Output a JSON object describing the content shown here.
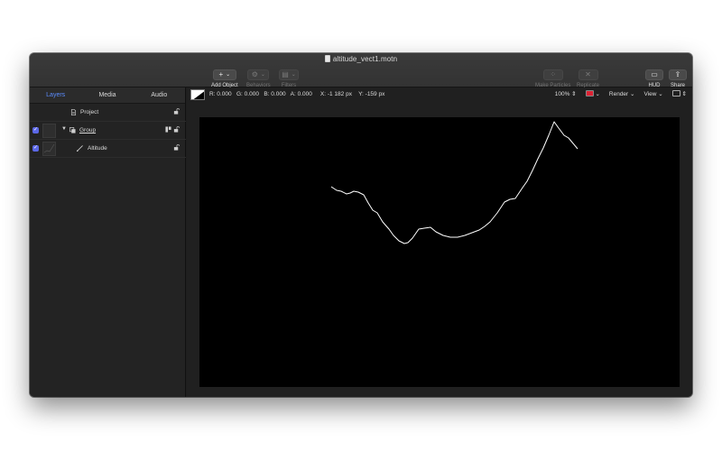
{
  "window": {
    "title": "altitude_vect1.motn"
  },
  "toolbar": {
    "add_object": {
      "label": "Add Object",
      "symbol": "+"
    },
    "behaviors": {
      "label": "Behaviors"
    },
    "filters": {
      "label": "Filters"
    },
    "make_particles": {
      "label": "Make Particles"
    },
    "replicate": {
      "label": "Replicate"
    },
    "hud": {
      "label": "HUD"
    },
    "share": {
      "label": "Share"
    }
  },
  "left_panel": {
    "tabs": [
      {
        "label": "Layers",
        "active": true
      },
      {
        "label": "Media",
        "active": false
      },
      {
        "label": "Audio",
        "active": false
      }
    ],
    "layers": [
      {
        "name": "Project",
        "checked": false
      },
      {
        "name": "Group",
        "checked": true
      },
      {
        "name": "Altitude",
        "checked": true
      }
    ],
    "check_mark": "✓"
  },
  "info_bar": {
    "r": "R: 0.000",
    "g": "G: 0.000",
    "b": "B: 0.000",
    "a": "A: 0.000",
    "x": "X:  -1 182 px",
    "y": "Y:  -159 px",
    "zoom": "100%",
    "render": "Render",
    "view": "View"
  },
  "colors": {
    "accent": "#5b8cff",
    "canvas": "#000000",
    "stroke": "#ffffff"
  }
}
